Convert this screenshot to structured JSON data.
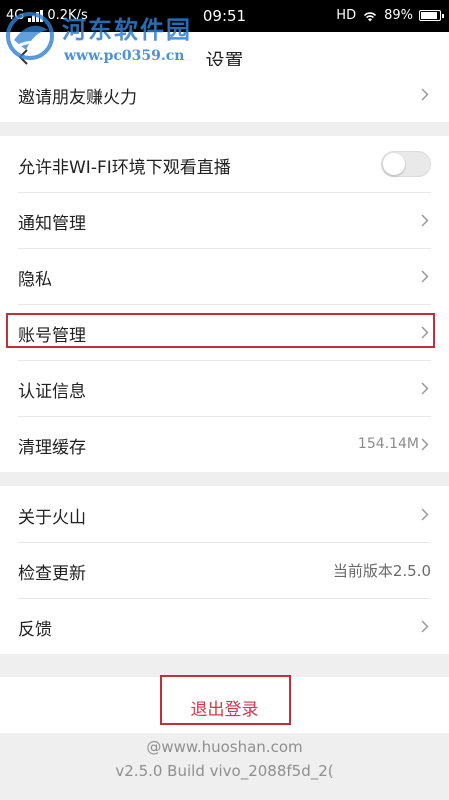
{
  "status_bar": {
    "network": "4G",
    "speed": "0.2K/s",
    "time": "09:51",
    "hd": "HD",
    "battery": "89%",
    "battery_level": 0.89
  },
  "watermark": {
    "name": "河东软件园",
    "url": "www.pc0359.cn",
    "color": "#2e7fd1"
  },
  "header": {
    "title": "设置"
  },
  "group1": [
    {
      "label": "邀请朋友赚火力"
    }
  ],
  "group2": [
    {
      "label": "允许非WI-FI环境下观看直播",
      "toggle": false
    },
    {
      "label": "通知管理"
    },
    {
      "label": "隐私"
    },
    {
      "label": "账号管理"
    },
    {
      "label": "认证信息"
    },
    {
      "label": "清理缓存",
      "value": "154.14M"
    }
  ],
  "group3": [
    {
      "label": "关于火山"
    },
    {
      "label": "检查更新",
      "value": "当前版本2.5.0"
    },
    {
      "label": "反馈"
    }
  ],
  "logout": {
    "label": "退出登录",
    "color": "#d33a49"
  },
  "footer": {
    "site": "@www.huoshan.com",
    "build": "v2.5.0 Build vivo_2088f5d_2("
  },
  "highlight_color": "#c0303a"
}
